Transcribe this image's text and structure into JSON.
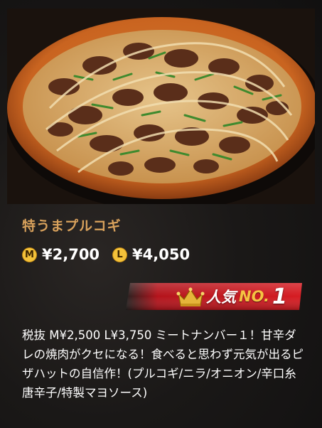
{
  "product": {
    "name": "特うまプルコギ",
    "image_alt": "pizza-photo"
  },
  "prices": [
    {
      "size": "M",
      "price": "¥2,700"
    },
    {
      "size": "L",
      "price": "¥4,050"
    }
  ],
  "rank": {
    "label": "人気",
    "no": "NO.",
    "num": "1"
  },
  "description": "税抜 M¥2,500 L¥3,750 ミートナンバー１！甘辛ダレの焼肉がクセになる！食べると思わず元気が出るピザハットの自信作！(プルコギ/ニラ/オニオン/辛口糸唐辛子/特製マヨソース)",
  "colors": {
    "title": "#d9a25c",
    "badge": "#f4c23a",
    "banner": "#c4121b",
    "crown": "#e6b43a"
  },
  "icons": {
    "crown": "crown-icon"
  }
}
